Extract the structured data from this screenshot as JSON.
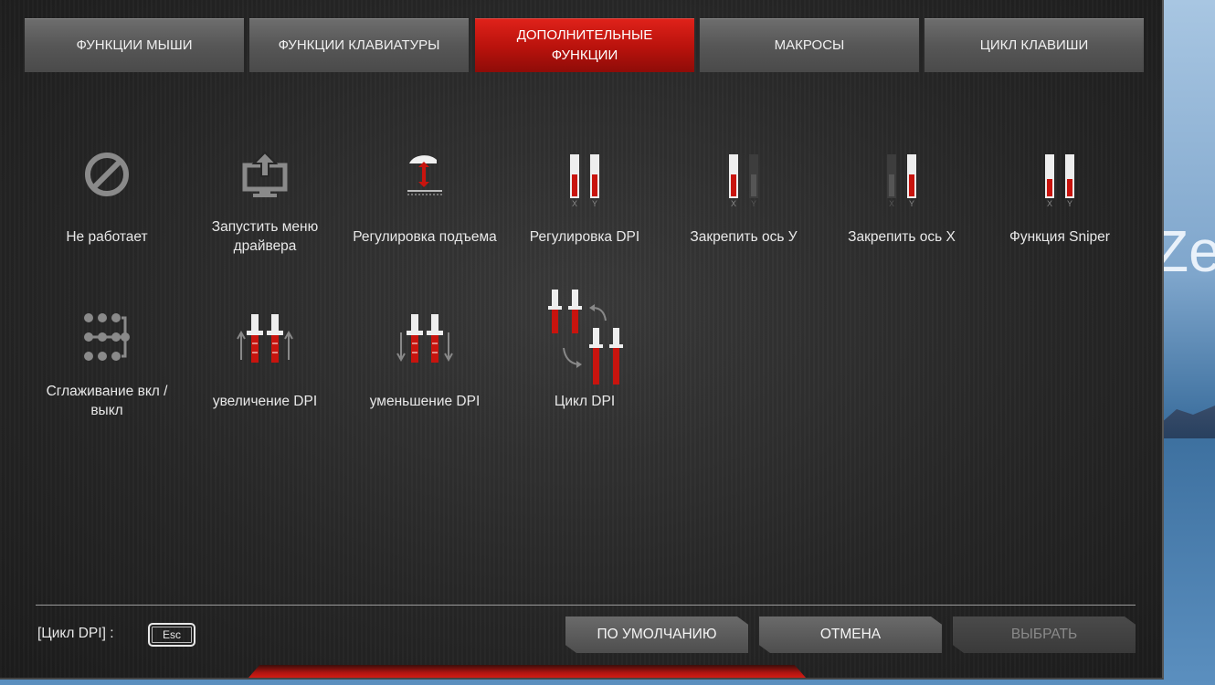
{
  "desktop": {
    "text": "Ze"
  },
  "tabs": [
    {
      "label": "ФУНКЦИИ МЫШИ",
      "active": false
    },
    {
      "label": "ФУНКЦИИ КЛАВИАТУРЫ",
      "active": false
    },
    {
      "label": "ДОПОЛНИТЕЛЬНЫЕ ФУНКЦИИ",
      "active": true
    },
    {
      "label": "МАКРОСЫ",
      "active": false
    },
    {
      "label": "ЦИКЛ КЛАВИШИ",
      "active": false
    }
  ],
  "functions": [
    {
      "label": "Не работает",
      "icon": "disabled-icon"
    },
    {
      "label": "Запустить меню драйвера",
      "icon": "driver-menu-icon"
    },
    {
      "label": "Регулировка подъема",
      "icon": "lift-adjust-icon"
    },
    {
      "label": "Регулировка DPI",
      "icon": "dpi-adjust-icon"
    },
    {
      "label": "Закрепить ось У",
      "icon": "lock-y-axis-icon"
    },
    {
      "label": "Закрепить ось X",
      "icon": "lock-x-axis-icon"
    },
    {
      "label": "Функция Sniper",
      "icon": "sniper-icon"
    },
    {
      "label": "Сглаживание вкл / выкл",
      "icon": "smoothing-icon"
    },
    {
      "label": "увеличение DPI",
      "icon": "dpi-up-icon"
    },
    {
      "label": "уменьшение DPI",
      "icon": "dpi-down-icon"
    },
    {
      "label": "Цикл DPI",
      "icon": "dpi-cycle-icon"
    }
  ],
  "axis_labels": {
    "x": "X",
    "y": "Y"
  },
  "footer": {
    "assignment_label": "[Цикл DPI] :",
    "key": "Esc",
    "default_button": "ПО УМОЛЧАНИЮ",
    "cancel_button": "ОТМЕНА",
    "select_button": "ВЫБРАТЬ"
  },
  "colors": {
    "accent": "#c8140e",
    "text": "#e8e8e8",
    "background": "#262626"
  }
}
